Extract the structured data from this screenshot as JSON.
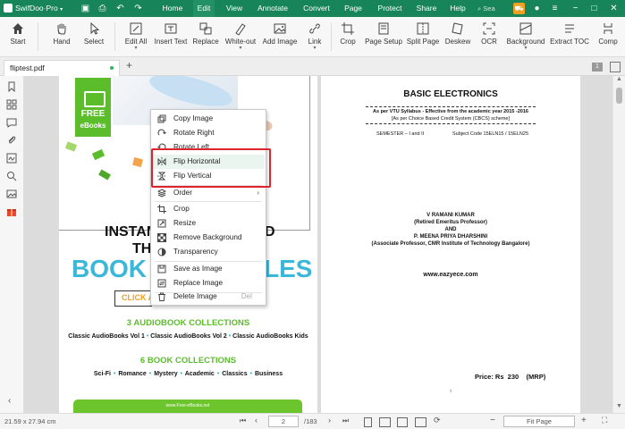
{
  "titlebar": {
    "app_name": "SwifDoo",
    "app_edition": "Pro",
    "menus": [
      "Home",
      "Edit",
      "View",
      "Annotate",
      "Convert",
      "Page",
      "Protect",
      "Share",
      "Help"
    ],
    "active_menu": "Edit",
    "search_placeholder": "Sea"
  },
  "toolbar": {
    "tools": [
      "Start",
      "Hand",
      "Select",
      "Edit All",
      "Insert Text",
      "Replace",
      "White-out",
      "Add Image",
      "Link",
      "Crop",
      "Page Setup",
      "Split Page",
      "Deskew",
      "OCR",
      "Background",
      "Extract TOC",
      "Comp"
    ]
  },
  "tabs": {
    "file_name": "fliptest.pdf",
    "add_label": "+",
    "page_badge": "1"
  },
  "context_menu": {
    "items": [
      {
        "label": "Copy Image",
        "icon": "copy-image-icon"
      },
      {
        "label": "Rotate Right",
        "icon": "rotate-right-icon"
      },
      {
        "label": "Rotate Left",
        "icon": "rotate-left-icon"
      },
      {
        "label": "Flip Horizontal",
        "icon": "flip-horizontal-icon"
      },
      {
        "label": "Flip Vertical",
        "icon": "flip-vertical-icon"
      },
      {
        "label": "Order",
        "icon": "order-icon",
        "submenu": "›"
      },
      {
        "label": "Crop",
        "icon": "crop-icon"
      },
      {
        "label": "Resize",
        "icon": "resize-icon"
      },
      {
        "label": "Remove Background",
        "icon": "remove-background-icon"
      },
      {
        "label": "Transparency",
        "icon": "transparency-icon"
      },
      {
        "label": "Save as Image",
        "icon": "save-image-icon"
      },
      {
        "label": "Replace Image",
        "icon": "replace-image-icon"
      },
      {
        "label": "Delete Image",
        "icon": "delete-image-icon",
        "shortcut": "Del"
      }
    ]
  },
  "page_left": {
    "badge_top": "FREE",
    "badge_bottom": "eBooks",
    "headline1a": "INSTAN",
    "headline1b": "D",
    "headline2a": "TH",
    "headline3a": "BOOK",
    "headline3b": "LES",
    "click_label": "CLICK A",
    "audio_heading": "3 AUDIOBOOK COLLECTIONS",
    "audio_items": [
      "Classic AudioBooks Vol 1",
      "Classic AudioBooks Vol 2",
      "Classic AudioBooks Kids"
    ],
    "book_heading": "6 BOOK COLLECTIONS",
    "book_items": [
      "Sci-Fi",
      "Romance",
      "Mystery",
      "Academic",
      "Classics",
      "Business"
    ],
    "footer_url": "www.Free-eBooks.net"
  },
  "page_right": {
    "title": "BASIC ELECTRONICS",
    "syllabus_line1": "As per VTU Syllabus - Effective from the academic year 2015 -2016",
    "syllabus_line2": "[As per Choice Based Credit System (CBCS) scheme]",
    "semester": "SEMESTER – I and II",
    "subject_code": "Subject Code 15ELN15 / 15ELN25",
    "author1": "V RAMANI KUMAR",
    "author1_title": "(Retired Emeritus Professor)",
    "and": "AND",
    "author2": "P. MEENA PRIYA DHARSHINI",
    "author2_title": "(Associate Professor, CMR Institute of Technology Bangalore)",
    "website": "www.eazyece.com",
    "price": "Price: Rs  230    (MRP)",
    "footnote": "i"
  },
  "statusbar": {
    "page_size": "21.59 x 27.94 cm",
    "current_page": "2",
    "total_pages": "/183",
    "zoom": "Fit Page"
  },
  "colors": {
    "titlebar": "#17845a",
    "accent_green": "#5bbd2a",
    "highlight_red": "#e0232b",
    "cyan": "#3bb7d9"
  }
}
